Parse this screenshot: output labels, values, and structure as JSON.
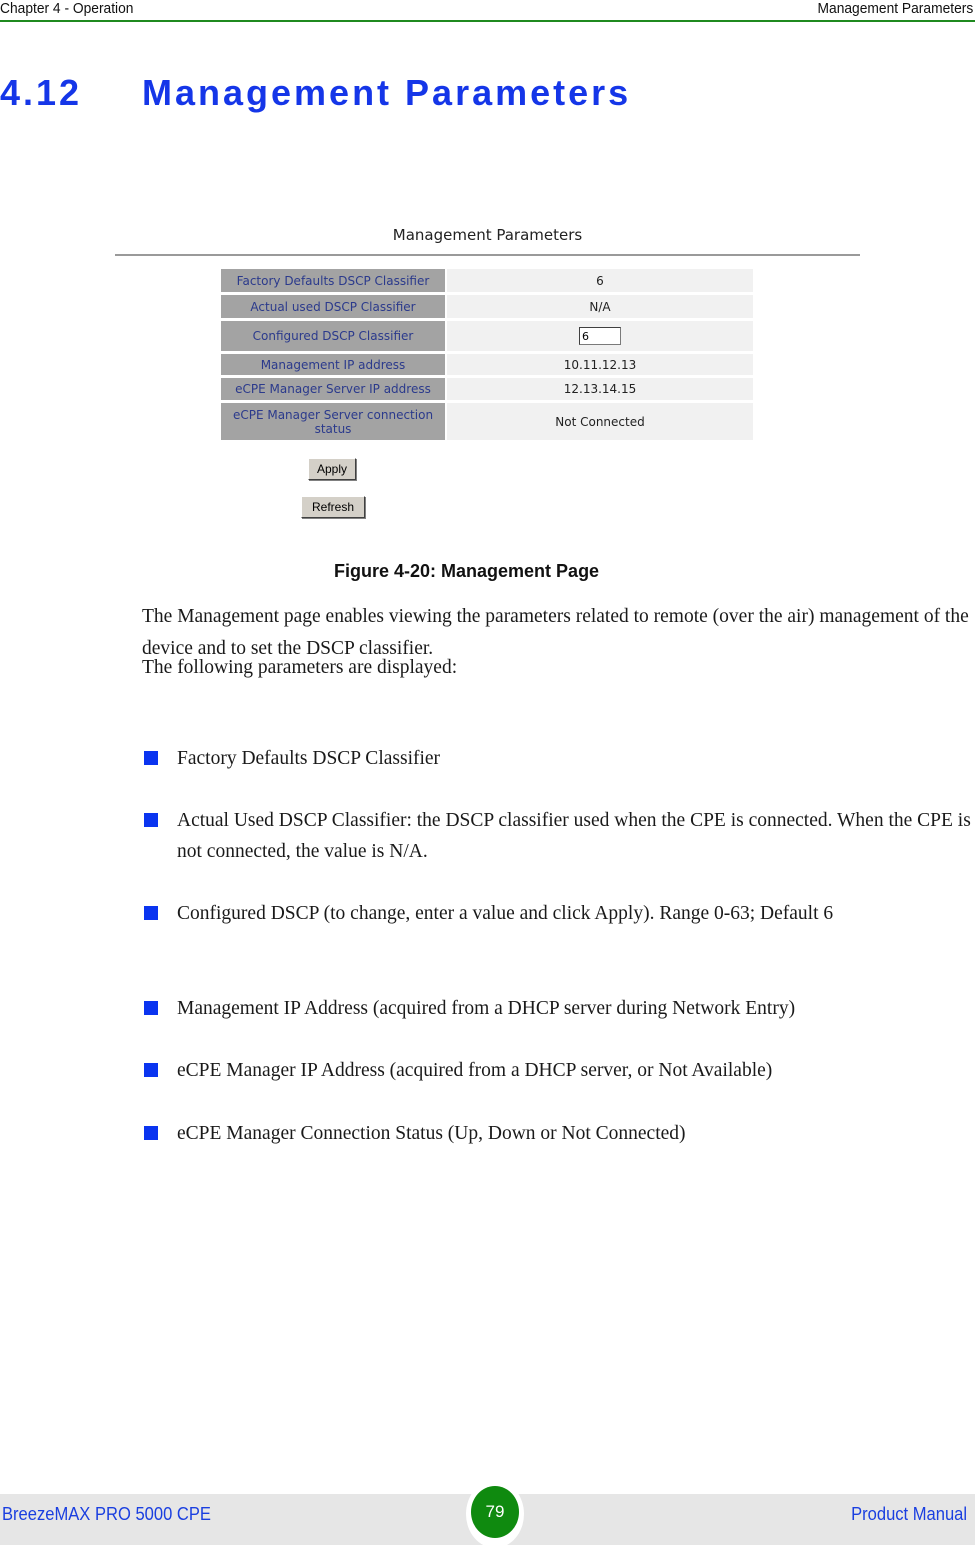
{
  "header": {
    "left": "Chapter 4 - Operation",
    "right": "Management Parameters"
  },
  "section": {
    "number": "4.12",
    "title": "Management Parameters"
  },
  "figure": {
    "title": "Management Parameters",
    "rows": [
      {
        "label": "Factory Defaults DSCP Classifier",
        "value": "6"
      },
      {
        "label": "Actual used DSCP Classifier",
        "value": "N/A"
      },
      {
        "label": "Configured DSCP Classifier",
        "input_value": "6"
      },
      {
        "label": "Management IP address",
        "value": "10.11.12.13"
      },
      {
        "label": "eCPE Manager Server IP address",
        "value": "12.13.14.15"
      },
      {
        "label": "eCPE Manager Server connection status",
        "value": "Not Connected"
      }
    ],
    "apply_label": "Apply",
    "refresh_label": "Refresh",
    "caption": "Figure 4-20: Management Page"
  },
  "body": {
    "intro": "The Management page enables viewing the parameters related to remote (over the air) management of the device and to set the DSCP classifier.",
    "lead": "The following parameters are displayed:",
    "bullets": [
      "Factory Defaults DSCP Classifier",
      "Actual Used DSCP Classifier: the DSCP classifier used when the CPE is connected. When the CPE is not connected, the value is N/A.",
      "Configured DSCP (to change, enter a value and click Apply). Range 0-63; Default 6",
      "Management IP Address (acquired from a DHCP server during Network Entry)",
      "eCPE Manager IP Address (acquired from a DHCP server, or Not Available)",
      "eCPE Manager Connection Status (Up, Down or Not Connected)"
    ]
  },
  "footer": {
    "left": "BreezeMAX PRO 5000 CPE",
    "page_number": "79",
    "right": "Product Manual"
  },
  "colors": {
    "heading_blue": "#1536e8",
    "header_rule_green": "#1f8a1f",
    "bullet_blue": "#0a34f0",
    "page_badge_green": "#0f8a0f",
    "footer_text_blue": "#1a3fe0"
  }
}
